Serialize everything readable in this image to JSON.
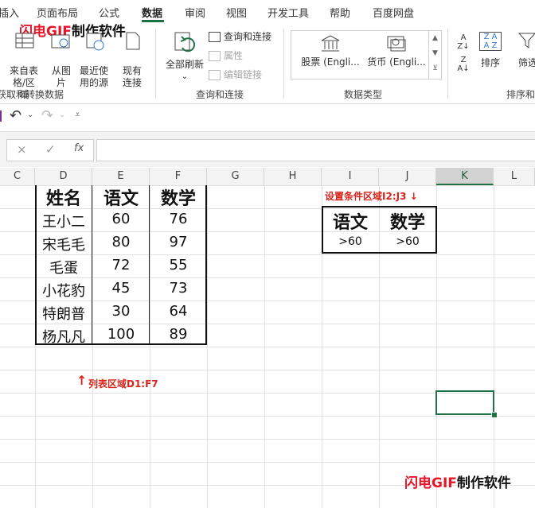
{
  "tabs": [
    "插入",
    "页面布局",
    "公式",
    "数据",
    "审阅",
    "视图",
    "开发工具",
    "帮助",
    "百度网盘"
  ],
  "active_tab": "数据",
  "watermark": "闪电GIF制作软件",
  "ribbon": {
    "btn_from_table": "来自表格/区域",
    "btn_from_image": "从图片",
    "btn_recent": "最近使用的源",
    "btn_existing": "现有连接",
    "btn_refresh_all": "全部刷新",
    "btn_queries": "查询和连接",
    "btn_properties": "属性",
    "btn_edit_links": "编辑链接",
    "datatype_stocks": "股票 (Engli...",
    "datatype_currency": "货币 (Engli...",
    "btn_sort": "排序",
    "btn_filter": "筛选",
    "group_get_data": "获取和转换数据",
    "group_queries": "查询和连接",
    "group_datatypes": "数据类型",
    "group_sort": "排序和筛"
  },
  "formula_bar": {
    "fx": "fx",
    "cancel": "×",
    "enter": "✓",
    "value": ""
  },
  "columns": [
    "C",
    "D",
    "E",
    "F",
    "G",
    "H",
    "I",
    "J",
    "K",
    "L"
  ],
  "selected_column": "K",
  "list_table": {
    "headers": [
      "姓名",
      "语文",
      "数学"
    ],
    "rows": [
      [
        "王小二",
        "60",
        "76"
      ],
      [
        "宋毛毛",
        "80",
        "97"
      ],
      [
        "毛蛋",
        "72",
        "55"
      ],
      [
        "小花豹",
        "45",
        "73"
      ],
      [
        "特朗普",
        "30",
        "64"
      ],
      [
        "杨凡凡",
        "100",
        "89"
      ]
    ]
  },
  "criteria_table": {
    "headers": [
      "语文",
      "数学"
    ],
    "values": [
      ">60",
      ">60"
    ]
  },
  "annotations": {
    "criteria_note": "设置条件区域I2:J3 ↓",
    "list_note_arrow": "↑",
    "list_note": "列表区域D1:F7"
  }
}
